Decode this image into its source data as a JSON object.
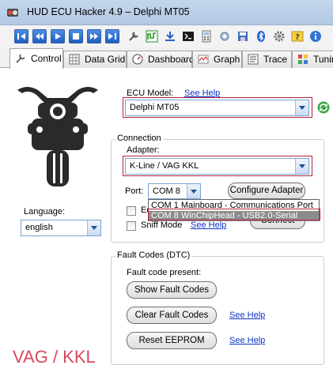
{
  "window": {
    "title": "HUD ECU Hacker 4.9  –  Delphi MT05"
  },
  "toolbar": {
    "buttons": [
      "first-icon",
      "previous-icon",
      "play-icon",
      "stop-icon",
      "next-icon",
      "last-icon",
      "wrench-icon",
      "chart-icon",
      "download-icon",
      "terminal-icon",
      "calculator-icon",
      "tools-icon",
      "bluetooth-icon",
      "settings-icon",
      "help-icon",
      "info-icon"
    ]
  },
  "tabs": [
    {
      "label": "Control",
      "icon": "wrench-icon",
      "active": true
    },
    {
      "label": "Data Grid",
      "icon": "grid-icon"
    },
    {
      "label": "Dashboard",
      "icon": "gauge-icon"
    },
    {
      "label": "Graph",
      "icon": "graph-icon"
    },
    {
      "label": "Trace",
      "icon": "trace-icon"
    },
    {
      "label": "Tunin",
      "icon": "tuning-icon"
    }
  ],
  "language": {
    "label": "Language:",
    "value": "english"
  },
  "ecu": {
    "label": "ECU Model:",
    "help_link": "See Help",
    "value": "Delphi MT05"
  },
  "connection": {
    "legend": "Connection",
    "adapter_label": "Adapter:",
    "adapter_value": "K-Line / VAG KKL",
    "port_label": "Port:",
    "port_value": "COM  8",
    "configure_button": "Configure Adapter",
    "echo_checkbox": "Ec",
    "sniff_checkbox": "Sniff Mode",
    "sniff_help": "See Help",
    "connect_button": "Connect",
    "port_options": [
      "COM  1   Mainboard - Communications Port",
      "COM  8   WinChipHead - USB2.0-Serial"
    ]
  },
  "faults": {
    "legend": "Fault Codes (DTC)",
    "present_label": "Fault code present:",
    "show_button": "Show Fault Codes",
    "clear_button": "Clear Fault Codes",
    "clear_help": "See Help",
    "reset_button": "Reset EEPROM",
    "reset_help": "See Help"
  },
  "overlay_caption": "VAG / KKL",
  "colors": {
    "accent_red": "#b3243b",
    "link_blue": "#0b32c8",
    "caption_red": "#d9475e"
  }
}
